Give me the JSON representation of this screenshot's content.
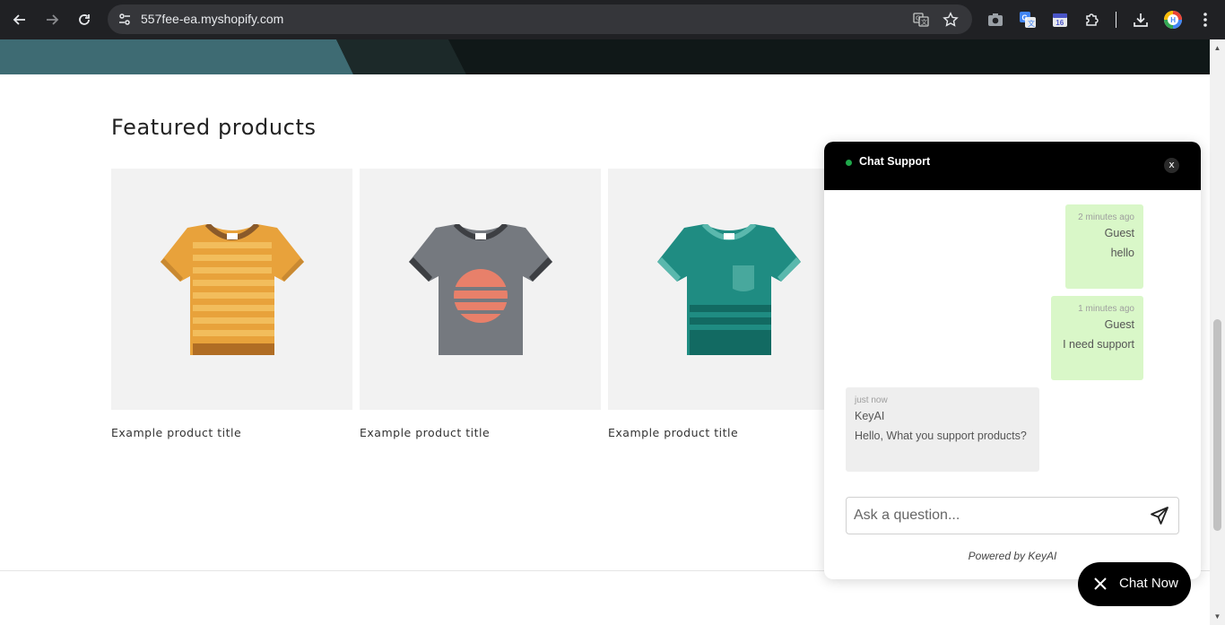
{
  "browser": {
    "url": "557fee-ea.myshopify.com",
    "icons": [
      "back-icon",
      "forward-icon",
      "reload-icon",
      "site-info-icon",
      "translate-icon",
      "bookmark-star-icon",
      "screenshot-icon",
      "google-translate-extension-icon",
      "calendar-extension-icon",
      "extensions-puzzle-icon",
      "download-icon",
      "profile-avatar-icon",
      "menu-kebab-icon"
    ],
    "calendar_badge": "16"
  },
  "page": {
    "section_title": "Featured products",
    "products": [
      {
        "title": "Example product title",
        "shirt": "striped-orange"
      },
      {
        "title": "Example product title",
        "shirt": "gray-sun"
      },
      {
        "title": "Example product title",
        "shirt": "teal-pocket"
      }
    ],
    "colors": {
      "banner_dark": "#121a1a",
      "banner_teal": "#3e6b73",
      "card_bg": "#f2f2f2"
    }
  },
  "chat": {
    "title": "Chat Support",
    "close_label": "x",
    "messages": [
      {
        "role": "user",
        "time": "2 minutes ago",
        "sender": "Guest",
        "text": "hello"
      },
      {
        "role": "user",
        "time": "1 minutes ago",
        "sender": "Guest",
        "text": "I need support"
      },
      {
        "role": "bot",
        "time": "just now",
        "sender": "KeyAI",
        "text": "Hello, What you support products?"
      }
    ],
    "input_placeholder": "Ask a question...",
    "powered_by": "Powered by KeyAI",
    "colors": {
      "user_bubble": "#d9f7c8",
      "bot_bubble": "#eeeeee",
      "status_online": "#1fa84a"
    }
  },
  "launcher": {
    "label": "Chat Now"
  }
}
